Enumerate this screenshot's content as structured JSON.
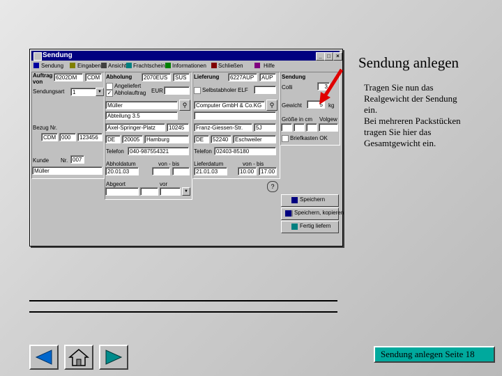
{
  "window": {
    "title": "Sendung",
    "controls": {
      "minimize": "_",
      "maximize": "□",
      "close": "×"
    }
  },
  "menu": [
    "Sendung",
    "Eingaben",
    "Ansicht",
    "Frachtschein",
    "Informationen",
    "Schließen",
    "Hilfe"
  ],
  "auftrag": {
    "label": "Auftrag von",
    "code1": "6202DM",
    "code2": "CDM",
    "sendungsart_label": "Sendungsart",
    "sendungsart_value": "1",
    "bezug_label": "Bezug Nr.",
    "bezug_values": [
      "CDM",
      "000",
      "123456"
    ],
    "kunde_label": "Kunde",
    "kunde_nr_label": "Nr.",
    "kunde_nr": "007",
    "kunde_name": "Müller"
  },
  "abholung": {
    "label": "Abholung",
    "code1": "2070EUS",
    "code2": "SUS",
    "angeliefert_label": "Angeliefert",
    "abholauftrag_label": "Abholauftrag",
    "eur_label": "EUR",
    "name": "Müller",
    "abteilung": "Abteilung 3.5",
    "strasse": "Axel-Springer-Platz",
    "hausnr": "10245",
    "land": "DE",
    "plz": "20005",
    "ort": "Hamburg",
    "telefon_label": "Telefon",
    "telefon": "040-987554321",
    "abholdatum_label": "Abholdatum",
    "vonbis_label": "von - bis",
    "abholdatum": "20.01.03",
    "abgeort_label": "Abgeort",
    "vor_label": "vor"
  },
  "lieferung": {
    "label": "Lieferung",
    "code1": "6227AUP",
    "code2": "AUP",
    "selbstabholer_label": "Selbstabholer ELF",
    "name": "Computer GmbH & Co.KG",
    "strasse": "Franz-Giessen-Str.",
    "hausnr": "5J",
    "land": "DE",
    "plz": "52240",
    "ort": "Eschweiler",
    "telefon_label": "Telefon",
    "telefon": "02403-85180",
    "lieferdatum_label": "Lieferdatum",
    "vonbis_label": "von - bis",
    "lieferdatum": "21.01.03",
    "von": "10.00",
    "bis": "17.00"
  },
  "sendung": {
    "label": "Sendung",
    "colli_label": "Colli",
    "colli": "3",
    "gewicht_label": "Gewicht",
    "gewicht": "5",
    "gewicht_unit": "kg",
    "groesse_label": "Größe in cm",
    "volgew_label": "Volgew",
    "briefkasten_label": "Briefkasten OK"
  },
  "buttons": {
    "speichern": "Speichern",
    "speichern_kopieren": "Speichern, kopieren",
    "fertig_liefern": "Fertig liefern"
  },
  "slide": {
    "heading": "Sendung anlegen",
    "description_lines": [
      "Tragen Sie nun das",
      "Realgewicht der Sendung",
      "ein.",
      "Bei mehreren Packstücken",
      "tragen Sie hier das",
      "Gesamtgewicht ein."
    ],
    "footer_label": "Sendung anlegen Seite 18"
  },
  "nav_icons": [
    "arrow-left-icon",
    "home-icon",
    "arrow-right-icon"
  ],
  "colors": {
    "titlebar": "#000080",
    "window": "#c0c0c0",
    "footer_box": "#00a99d",
    "pointer_arrow": "#e00000"
  }
}
